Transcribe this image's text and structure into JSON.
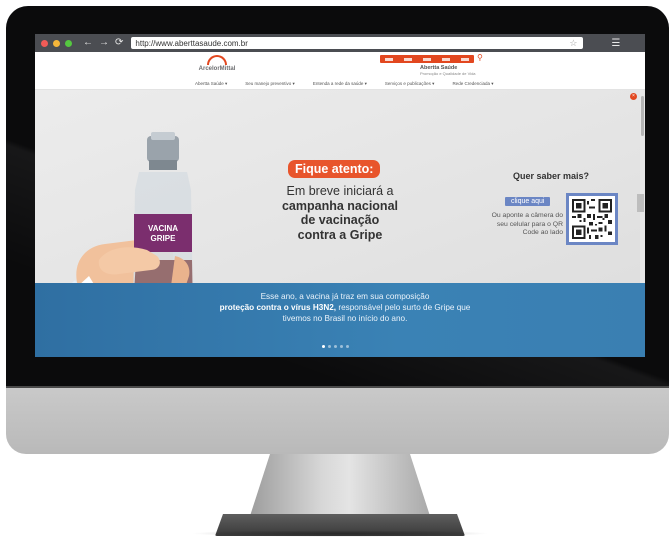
{
  "browser": {
    "url": "http://www.aberttasaude.com.br",
    "traffic_colors": [
      "#f15b57",
      "#f6b63a",
      "#55c840"
    ],
    "back_glyph": "←",
    "forward_glyph": "→",
    "reload_glyph": "⟳",
    "star_glyph": "☆",
    "menu_glyph": "☰"
  },
  "site": {
    "logo_text": "ArcelorMittal",
    "brand_title": "Abertta Saúde",
    "brand_subtitle": "Promoção e Qualidade de Vida",
    "menu": [
      "Abertta Saúde ▾",
      "Seu manejo preventivo ▾",
      "Entenda a rede da saúde ▾",
      "Serviços e publicações ▾",
      "Rede Credenciada ▾"
    ],
    "accent_color": "#e2471f"
  },
  "hero": {
    "badge": "Fique atento:",
    "line1": "Em breve iniciará a",
    "line2": "campanha nacional",
    "line3": "de vacinação",
    "line4": "contra a Gripe",
    "vial_label_1": "VACINA",
    "vial_label_2": "GRIPE",
    "qs_title": "Quer saber mais?",
    "click_label": "clique aqui",
    "qs_desc": "Ou aponte a câmera do seu celular para o QR Code ao lado",
    "band_pre": "Esse ano, a vacina já traz em sua composição",
    "band_bold": "proteção contra o vírus H3N2,",
    "band_post": " responsável pelo surto de Gripe que tivemos no Brasil no início do ano.",
    "slide_count": 5,
    "active_slide": 1
  }
}
